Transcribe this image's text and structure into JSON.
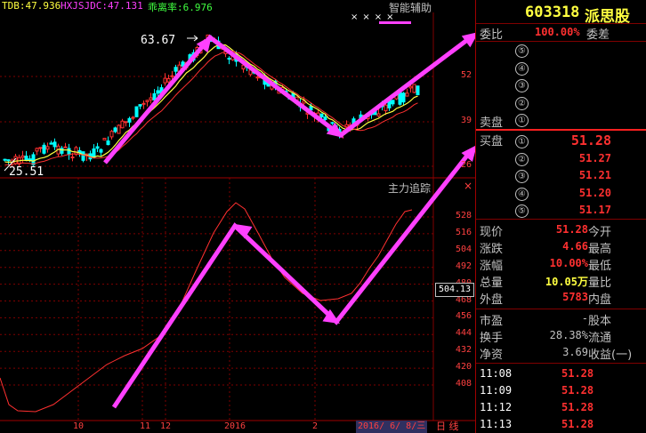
{
  "main_chart": {
    "indicators": [
      {
        "label": "TDB:47.936",
        "color": "#ffff40"
      },
      {
        "label": "HXJSJDC:47.131",
        "color": "#ff40ff"
      },
      {
        "label": "乖离率:6.976",
        "color": "#40ff40"
      }
    ],
    "panel_title": "智能辅助",
    "top_icons": [
      "×",
      "×",
      "×",
      "×"
    ],
    "high_label": "63.67",
    "low_label": "25.51",
    "y_ticks": [
      "52",
      "39",
      "26"
    ]
  },
  "sub_chart": {
    "title": "主力追踪",
    "y_ticks": [
      "528",
      "516",
      "504",
      "492",
      "480",
      "468",
      "456",
      "444",
      "432",
      "420",
      "408"
    ],
    "current_value": "504.13"
  },
  "x_axis": {
    "labels": [
      "10",
      "11",
      "12",
      "2016",
      "2"
    ],
    "cursor_date": "2016/ 6/ 8/三",
    "period_tab": "日 线"
  },
  "quote": {
    "code": "603318",
    "name": "派思股",
    "weibi_label": "委比",
    "weibi_value": "100.00%",
    "weicha_label": "委差",
    "sell_label": "卖盘",
    "buy_label": "买盘",
    "sell_levels": [
      "⑤",
      "④",
      "③",
      "②",
      "①"
    ],
    "buy_levels": [
      {
        "n": "①",
        "price": "51.28"
      },
      {
        "n": "②",
        "price": "51.27"
      },
      {
        "n": "③",
        "price": "51.21"
      },
      {
        "n": "④",
        "price": "51.20"
      },
      {
        "n": "⑤",
        "price": "51.17"
      }
    ],
    "stats": [
      {
        "l1": "现价",
        "v1": "51.28",
        "c1": "#ff3030",
        "l2": "今开",
        "v2": ""
      },
      {
        "l1": "涨跌",
        "v1": "4.66",
        "c1": "#ff3030",
        "l2": "最高",
        "v2": ""
      },
      {
        "l1": "涨幅",
        "v1": "10.00%",
        "c1": "#ff3030",
        "l2": "最低",
        "v2": ""
      },
      {
        "l1": "总量",
        "v1": "10.05万",
        "c1": "#ffff40",
        "l2": "量比",
        "v2": ""
      },
      {
        "l1": "外盘",
        "v1": "5783",
        "c1": "#ff3030",
        "l2": "内盘",
        "v2": ""
      }
    ],
    "stats2": [
      {
        "l1": "市盈",
        "v1": "-",
        "l2": "股本"
      },
      {
        "l1": "换手",
        "v1": "28.38%",
        "l2": "流通"
      },
      {
        "l1": "净资",
        "v1": "3.69",
        "l2": "收益(一)"
      }
    ],
    "ticks": [
      {
        "time": "11:08",
        "price": "51.28"
      },
      {
        "time": "11:09",
        "price": "51.28"
      },
      {
        "time": "11:12",
        "price": "51.28"
      },
      {
        "time": "11:13",
        "price": "51.28"
      }
    ]
  },
  "colors": {
    "up": "#ff3030",
    "down": "#00ffff",
    "arrow": "#ff40ff",
    "grid": "#800000",
    "ma_yellow": "#ffff40",
    "ma_red": "#ff3030"
  }
}
